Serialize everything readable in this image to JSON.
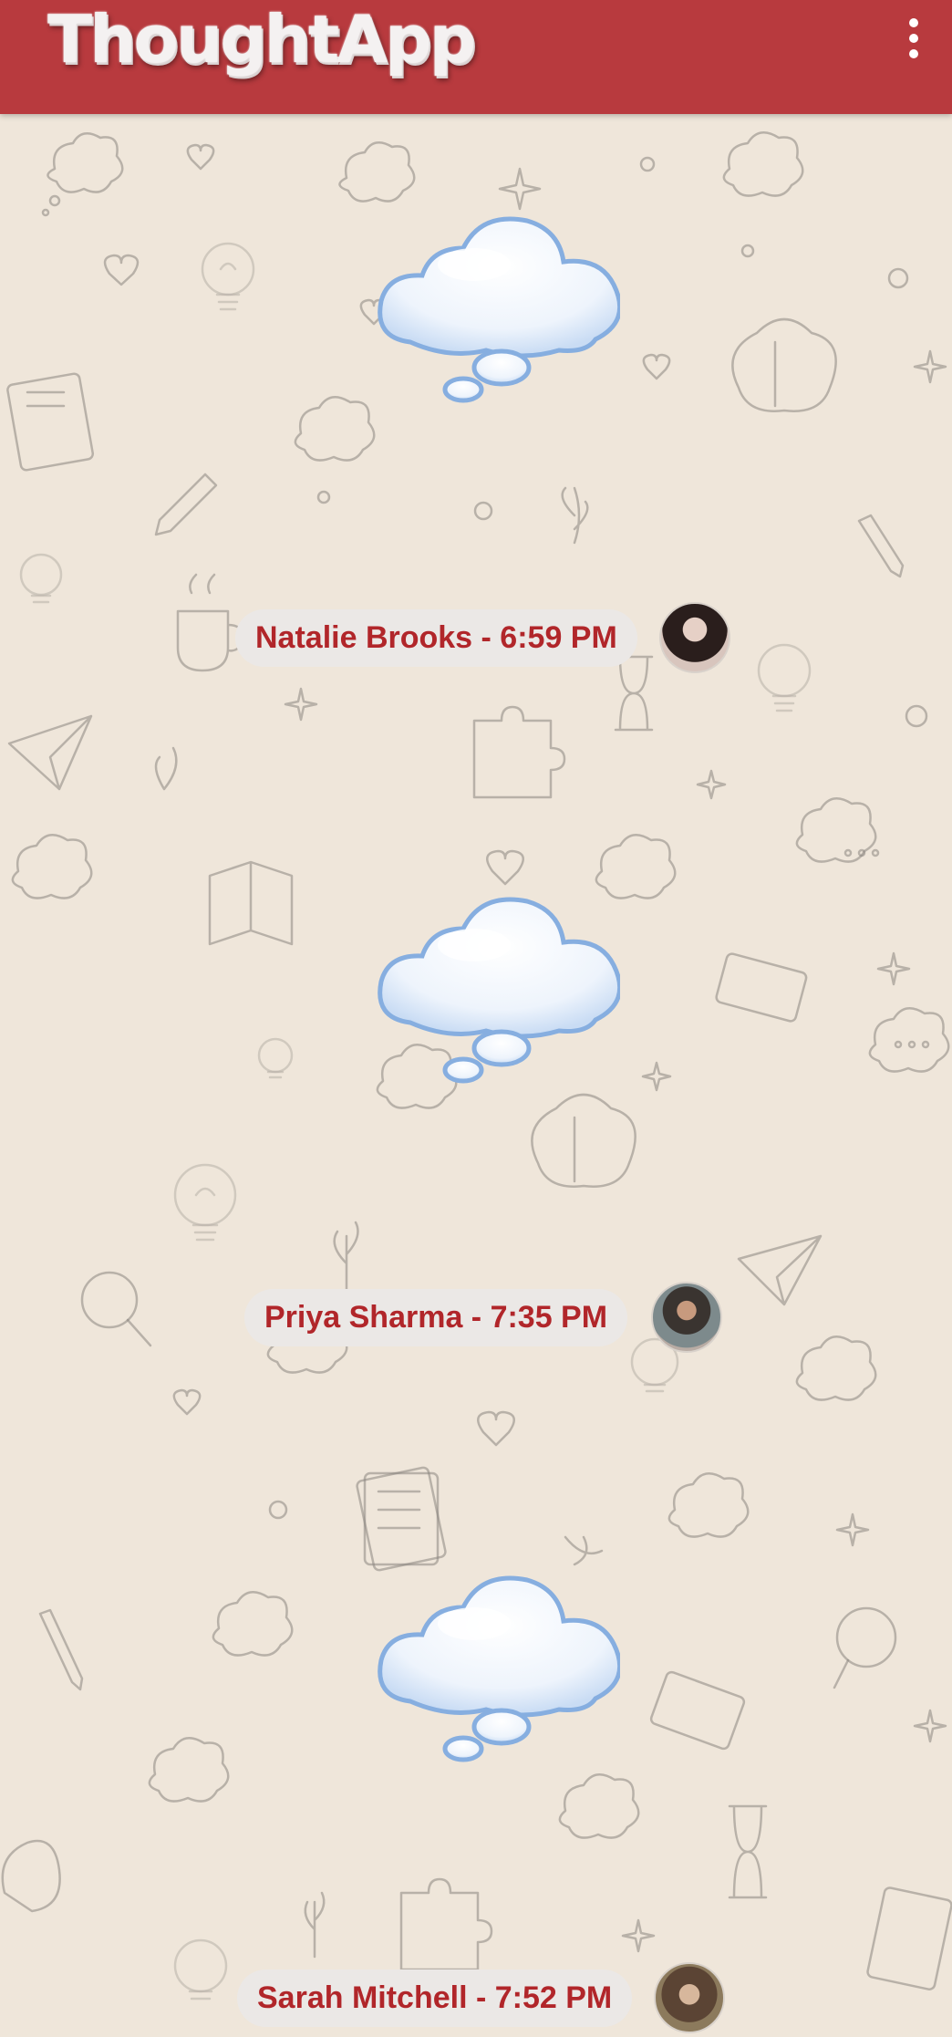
{
  "app": {
    "title": "ThoughtApp"
  },
  "header": {
    "menu_icon": "more-vertical-icon"
  },
  "colors": {
    "header_bg": "#b83a3e",
    "accent_text": "#b1262a",
    "pill_bg": "#ebe8e6",
    "page_bg": "#efe6da"
  },
  "posts": [
    {
      "author": "Natalie Brooks",
      "time": "6:59 PM",
      "label": "Natalie Brooks - 6:59 PM",
      "avatar": "avatar-natalie"
    },
    {
      "author": "Priya Sharma",
      "time": "7:35 PM",
      "label": "Priya Sharma - 7:35 PM",
      "avatar": "avatar-priya"
    },
    {
      "author": "Sarah Mitchell",
      "time": "7:52 PM",
      "label": "Sarah Mitchell - 7:52 PM",
      "avatar": "avatar-sarah"
    }
  ]
}
